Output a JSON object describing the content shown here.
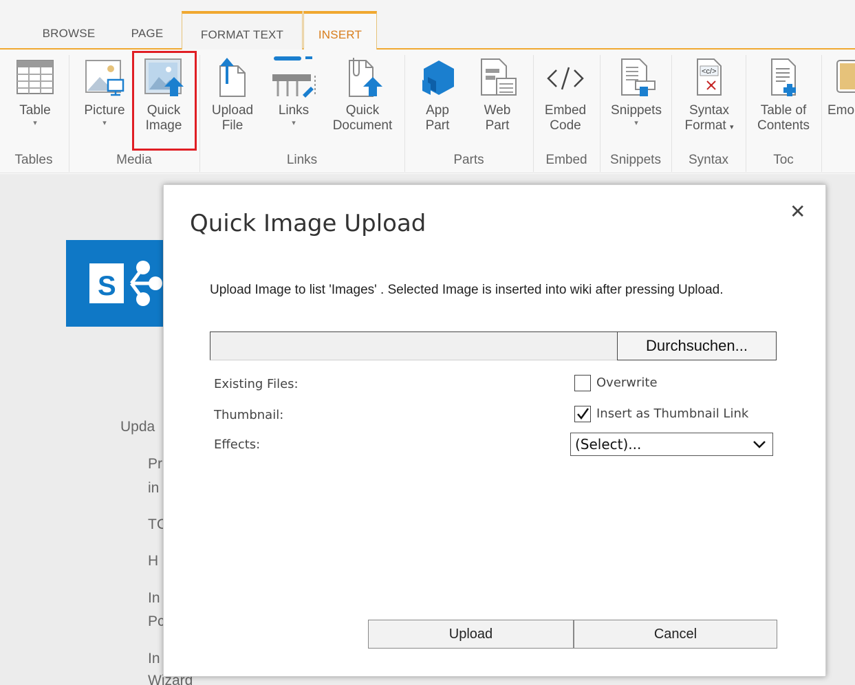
{
  "ribbon_tabs": [
    "BROWSE",
    "PAGE",
    "FORMAT TEXT",
    "INSERT"
  ],
  "ribbon_buttons": {
    "table": "Table",
    "picture": "Picture",
    "quick_image": [
      "Quick",
      "Image"
    ],
    "upload_file": [
      "Upload",
      "File"
    ],
    "links": "Links",
    "quick_document": [
      "Quick",
      "Document"
    ],
    "app_part": [
      "App",
      "Part"
    ],
    "web_part": [
      "Web",
      "Part"
    ],
    "embed_code": [
      "Embed",
      "Code"
    ],
    "snippets": "Snippets",
    "syntax_format": [
      "Syntax",
      "Format"
    ],
    "table_of_contents": [
      "Table of",
      "Contents"
    ],
    "emoji": "Emo"
  },
  "ribbon_groups": [
    "Tables",
    "Media",
    "Links",
    "Parts",
    "Embed",
    "Snippets",
    "Syntax",
    "Toc"
  ],
  "page_text": [
    "Upda",
    "Pr",
    "in",
    "TC",
    "H",
    "In",
    "Pc",
    "In",
    "Wizard"
  ],
  "dialog": {
    "title": "Quick Image Upload",
    "description": "Upload Image to list 'Images' . Selected Image is inserted into wiki after pressing Upload.",
    "browse_label": "Durchsuchen...",
    "labels": {
      "existing_files": "Existing Files:",
      "thumbnail": "Thumbnail:",
      "effects": "Effects:"
    },
    "overwrite_label": "Overwrite",
    "overwrite_checked": false,
    "thumbnail_label": "Insert as Thumbnail Link",
    "thumbnail_checked": true,
    "effects_value": "(Select)...",
    "upload_button": "Upload",
    "cancel_button": "Cancel",
    "close_glyph": "✕"
  },
  "colors": {
    "accent": "#f0a830",
    "active_tab": "#d87d1b",
    "highlight": "#e01e24",
    "icon_blue": "#1b7fcf",
    "sharepoint_blue": "#0f78c6"
  }
}
